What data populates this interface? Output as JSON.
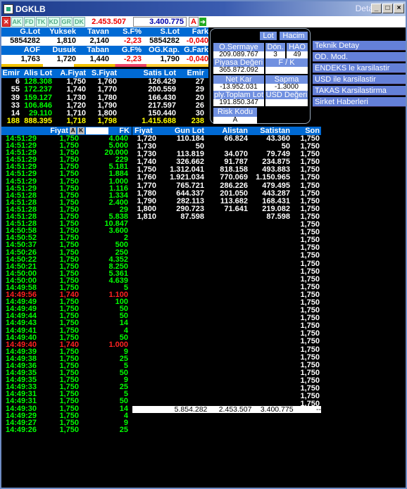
{
  "window": {
    "title": "DGKLB",
    "right_title": "Detay",
    "buttons": [
      "_",
      "□",
      "×"
    ]
  },
  "toolbar": {
    "tags": [
      "AK",
      "FD",
      "TK",
      "KD",
      "GR",
      "DK"
    ],
    "value1": "2.453.507",
    "value2": "3.400.775",
    "a_label": "A"
  },
  "summary": {
    "headers1": [
      "G.Lot",
      "Yuksek",
      "Tavan",
      "S.F%",
      "S.Lot",
      "Fark"
    ],
    "values1": [
      "5854282",
      "1,810",
      "2,140",
      "-2,23",
      "5854282",
      "-0,040"
    ],
    "headers2": [
      "AOF",
      "Dusuk",
      "Taban",
      "G.F%",
      "OG.Kap.",
      "G.Fark"
    ],
    "values2": [
      "1,763",
      "1,720",
      "1,440",
      "-2,23",
      "1,790",
      "-0,040"
    ]
  },
  "depth": {
    "headers": [
      "Emir",
      "Alis Lot",
      "A.Fiyat",
      "S.Fiyat",
      "Satis Lot",
      "Emir"
    ],
    "rows": [
      [
        "6",
        "128.308",
        "1,750",
        "1,760",
        "126.429",
        "27"
      ],
      [
        "55",
        "172.237",
        "1,740",
        "1,770",
        "200.559",
        "29"
      ],
      [
        "39",
        "159.127",
        "1,730",
        "1,780",
        "166.430",
        "20"
      ],
      [
        "33",
        "106.846",
        "1,720",
        "1,790",
        "217.597",
        "26"
      ],
      [
        "14",
        "29.110",
        "1,710",
        "1,800",
        "150.440",
        "30"
      ]
    ],
    "total": [
      "188",
      "888.395",
      "1,718",
      "1,798",
      "1.415.688",
      "238"
    ]
  },
  "trades_header": {
    "fiyat": "Fiyat",
    "a": "A",
    "k": "K",
    "fk": "FK"
  },
  "trades": [
    [
      "14:51:29",
      "1,750",
      "4.040",
      0
    ],
    [
      "14:51:29",
      "1,750",
      "5.000",
      0
    ],
    [
      "14:51:29",
      "1,750",
      "20.000",
      0
    ],
    [
      "14:51:29",
      "1,750",
      "229",
      0
    ],
    [
      "14:51:29",
      "1,750",
      "5.181",
      0
    ],
    [
      "14:51:29",
      "1,750",
      "1.884",
      0
    ],
    [
      "14:51:29",
      "1,750",
      "1.000",
      0
    ],
    [
      "14:51:29",
      "1,750",
      "1.116",
      0
    ],
    [
      "14:51:28",
      "1,750",
      "1.334",
      0
    ],
    [
      "14:51:28",
      "1,750",
      "2.400",
      0
    ],
    [
      "14:51:28",
      "1,750",
      "29",
      0
    ],
    [
      "14:51:28",
      "1,750",
      "5.838",
      0
    ],
    [
      "14:51:28",
      "1,750",
      "10.847",
      0
    ],
    [
      "14:50:58",
      "1,750",
      "3.600",
      0
    ],
    [
      "14:50:52",
      "1,750",
      "2",
      0
    ],
    [
      "14:50:37",
      "1,750",
      "500",
      0
    ],
    [
      "14:50:26",
      "1,750",
      "250",
      0
    ],
    [
      "14:50:22",
      "1,750",
      "4.352",
      0
    ],
    [
      "14:50:21",
      "1,750",
      "8.250",
      0
    ],
    [
      "14:50:00",
      "1,750",
      "5.361",
      0
    ],
    [
      "14:50:00",
      "1,750",
      "4.639",
      0
    ],
    [
      "14:49:58",
      "1,750",
      "5",
      0
    ],
    [
      "14:49:56",
      "1,740",
      "1.100",
      1
    ],
    [
      "14:49:49",
      "1,750",
      "100",
      0
    ],
    [
      "14:49:49",
      "1,750",
      "50",
      0
    ],
    [
      "14:49:44",
      "1,750",
      "50",
      0
    ],
    [
      "14:49:43",
      "1,750",
      "14",
      0
    ],
    [
      "14:49:41",
      "1,750",
      "4",
      0
    ],
    [
      "14:49:40",
      "1,750",
      "50",
      0
    ],
    [
      "14:49:40",
      "1,740",
      "1.000",
      1
    ],
    [
      "14:49:39",
      "1,750",
      "9",
      0
    ],
    [
      "14:49:38",
      "1,750",
      "25",
      0
    ],
    [
      "14:49:36",
      "1,750",
      "5",
      0
    ],
    [
      "14:49:35",
      "1,750",
      "50",
      0
    ],
    [
      "14:49:35",
      "1,750",
      "9",
      0
    ],
    [
      "14:49:33",
      "1,750",
      "25",
      0
    ],
    [
      "14:49:31",
      "1,750",
      "5",
      0
    ],
    [
      "14:49:31",
      "1,750",
      "50",
      0
    ],
    [
      "14:49:30",
      "1,750",
      "14",
      0
    ],
    [
      "14:49:29",
      "1,750",
      "4",
      0
    ],
    [
      "14:49:27",
      "1,750",
      "9",
      0
    ],
    [
      "14:49:26",
      "1,750",
      "25",
      0
    ]
  ],
  "levels_header": [
    "Fiyat",
    "Gun Lot",
    "Alistan",
    "Satistan",
    "Son"
  ],
  "levels": [
    [
      "1,720",
      "110.184",
      "66.824",
      "43.360",
      "1,750"
    ],
    [
      "1,730",
      "50",
      "",
      "50",
      "1,750"
    ],
    [
      "1,730",
      "113.819",
      "34.070",
      "79.749",
      "1,750"
    ],
    [
      "1,740",
      "326.662",
      "91.787",
      "234.875",
      "1,750"
    ],
    [
      "1,750",
      "1.312.041",
      "818.158",
      "493.883",
      "1,750"
    ],
    [
      "1,760",
      "1.921.034",
      "770.069",
      "1.150.965",
      "1,750"
    ],
    [
      "1,770",
      "765.721",
      "286.226",
      "479.495",
      "1,750"
    ],
    [
      "1,780",
      "644.337",
      "201.050",
      "443.287",
      "1,750"
    ],
    [
      "1,790",
      "282.113",
      "113.682",
      "168.431",
      "1,750"
    ],
    [
      "1,800",
      "290.723",
      "71.641",
      "219.082",
      "1,750"
    ],
    [
      "1,810",
      "87.598",
      "",
      "87.598",
      "1,750"
    ],
    [
      "",
      "",
      "",
      "",
      "1,750"
    ],
    [
      "",
      "",
      "",
      "",
      "1,750"
    ],
    [
      "",
      "",
      "",
      "",
      "1,750"
    ],
    [
      "",
      "",
      "",
      "",
      "1,750"
    ],
    [
      "",
      "",
      "",
      "",
      "1,750"
    ],
    [
      "",
      "",
      "",
      "",
      "1,750"
    ],
    [
      "",
      "",
      "",
      "",
      "1,750"
    ],
    [
      "",
      "",
      "",
      "",
      "1,750"
    ],
    [
      "",
      "",
      "",
      "",
      "1,750"
    ],
    [
      "",
      "",
      "",
      "",
      "1,750"
    ],
    [
      "",
      "",
      "",
      "",
      "1,750"
    ],
    [
      "",
      "",
      "",
      "",
      "1,750"
    ],
    [
      "",
      "",
      "",
      "",
      "1,750"
    ],
    [
      "",
      "",
      "",
      "",
      "1,750"
    ],
    [
      "",
      "",
      "",
      "",
      "1,750"
    ],
    [
      "",
      "",
      "",
      "",
      "1,750"
    ],
    [
      "",
      "",
      "",
      "",
      "1,750"
    ],
    [
      "",
      "",
      "",
      "",
      "1,750"
    ],
    [
      "",
      "",
      "",
      "",
      "1,750"
    ],
    [
      "",
      "",
      "",
      "",
      "1,750"
    ],
    [
      "",
      "",
      "",
      "",
      "1,750"
    ],
    [
      "",
      "",
      "",
      "",
      "1,750"
    ],
    [
      "",
      "",
      "",
      "",
      "1,750"
    ],
    [
      "",
      "",
      "",
      "",
      "1,750"
    ]
  ],
  "levels_total": {
    "gun_lot": "5.854.282",
    "alistan": "2.453.507",
    "satistan": "3.400.775",
    "son": "--"
  },
  "panel": {
    "lot_btn": "Lot",
    "hacim_btn": "Hacim",
    "sermaye_label": "O.Sermaye",
    "sermaye_value": "209.089.767",
    "don_label": "Dön.",
    "don_value": "3",
    "hao_label": "HAO",
    "hao_value": "49",
    "piyasa_label": "Piyasa Değeri",
    "piyasa_value": "365.872.092",
    "fk_label": "F / K",
    "fk_value": "",
    "netkar_label": "Net Kar",
    "netkar_value": "-13.952.031",
    "sapma_label": "Sapma",
    "sapma_value": "-1.3000",
    "ply_label": "ply.Toplam Lot",
    "ply_value": "191.850.347",
    "usd_label": "USD Değeri",
    "usd_value": "",
    "risk_label": "Risk Kodu",
    "risk_value": "A"
  },
  "menu": [
    "Teknik Detay",
    "OD. Mod.",
    "ENDEKS le karsilastir",
    "USD ile karsilastir",
    "TAKAS Karsilastirma",
    "Sirket Haberleri"
  ]
}
